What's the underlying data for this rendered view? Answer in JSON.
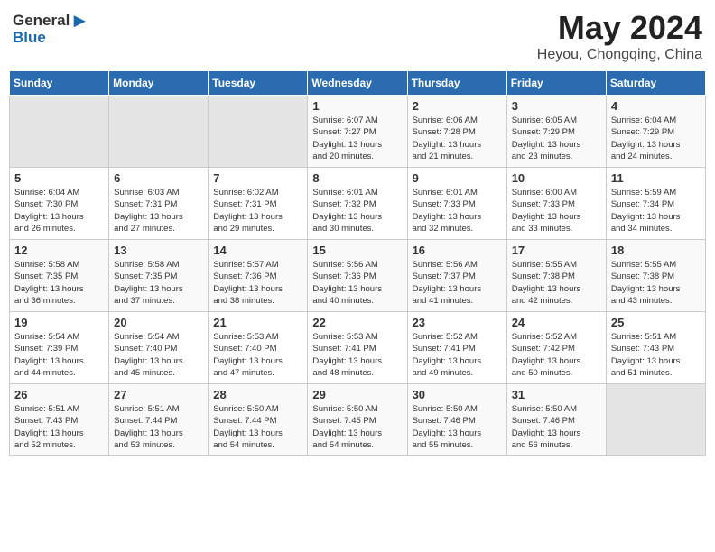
{
  "logo": {
    "general": "General",
    "blue": "Blue"
  },
  "title": {
    "month_year": "May 2024",
    "location": "Heyou, Chongqing, China"
  },
  "days_of_week": [
    "Sunday",
    "Monday",
    "Tuesday",
    "Wednesday",
    "Thursday",
    "Friday",
    "Saturday"
  ],
  "weeks": [
    [
      {
        "day": "",
        "info": ""
      },
      {
        "day": "",
        "info": ""
      },
      {
        "day": "",
        "info": ""
      },
      {
        "day": "1",
        "info": "Sunrise: 6:07 AM\nSunset: 7:27 PM\nDaylight: 13 hours\nand 20 minutes."
      },
      {
        "day": "2",
        "info": "Sunrise: 6:06 AM\nSunset: 7:28 PM\nDaylight: 13 hours\nand 21 minutes."
      },
      {
        "day": "3",
        "info": "Sunrise: 6:05 AM\nSunset: 7:29 PM\nDaylight: 13 hours\nand 23 minutes."
      },
      {
        "day": "4",
        "info": "Sunrise: 6:04 AM\nSunset: 7:29 PM\nDaylight: 13 hours\nand 24 minutes."
      }
    ],
    [
      {
        "day": "5",
        "info": "Sunrise: 6:04 AM\nSunset: 7:30 PM\nDaylight: 13 hours\nand 26 minutes."
      },
      {
        "day": "6",
        "info": "Sunrise: 6:03 AM\nSunset: 7:31 PM\nDaylight: 13 hours\nand 27 minutes."
      },
      {
        "day": "7",
        "info": "Sunrise: 6:02 AM\nSunset: 7:31 PM\nDaylight: 13 hours\nand 29 minutes."
      },
      {
        "day": "8",
        "info": "Sunrise: 6:01 AM\nSunset: 7:32 PM\nDaylight: 13 hours\nand 30 minutes."
      },
      {
        "day": "9",
        "info": "Sunrise: 6:01 AM\nSunset: 7:33 PM\nDaylight: 13 hours\nand 32 minutes."
      },
      {
        "day": "10",
        "info": "Sunrise: 6:00 AM\nSunset: 7:33 PM\nDaylight: 13 hours\nand 33 minutes."
      },
      {
        "day": "11",
        "info": "Sunrise: 5:59 AM\nSunset: 7:34 PM\nDaylight: 13 hours\nand 34 minutes."
      }
    ],
    [
      {
        "day": "12",
        "info": "Sunrise: 5:58 AM\nSunset: 7:35 PM\nDaylight: 13 hours\nand 36 minutes."
      },
      {
        "day": "13",
        "info": "Sunrise: 5:58 AM\nSunset: 7:35 PM\nDaylight: 13 hours\nand 37 minutes."
      },
      {
        "day": "14",
        "info": "Sunrise: 5:57 AM\nSunset: 7:36 PM\nDaylight: 13 hours\nand 38 minutes."
      },
      {
        "day": "15",
        "info": "Sunrise: 5:56 AM\nSunset: 7:36 PM\nDaylight: 13 hours\nand 40 minutes."
      },
      {
        "day": "16",
        "info": "Sunrise: 5:56 AM\nSunset: 7:37 PM\nDaylight: 13 hours\nand 41 minutes."
      },
      {
        "day": "17",
        "info": "Sunrise: 5:55 AM\nSunset: 7:38 PM\nDaylight: 13 hours\nand 42 minutes."
      },
      {
        "day": "18",
        "info": "Sunrise: 5:55 AM\nSunset: 7:38 PM\nDaylight: 13 hours\nand 43 minutes."
      }
    ],
    [
      {
        "day": "19",
        "info": "Sunrise: 5:54 AM\nSunset: 7:39 PM\nDaylight: 13 hours\nand 44 minutes."
      },
      {
        "day": "20",
        "info": "Sunrise: 5:54 AM\nSunset: 7:40 PM\nDaylight: 13 hours\nand 45 minutes."
      },
      {
        "day": "21",
        "info": "Sunrise: 5:53 AM\nSunset: 7:40 PM\nDaylight: 13 hours\nand 47 minutes."
      },
      {
        "day": "22",
        "info": "Sunrise: 5:53 AM\nSunset: 7:41 PM\nDaylight: 13 hours\nand 48 minutes."
      },
      {
        "day": "23",
        "info": "Sunrise: 5:52 AM\nSunset: 7:41 PM\nDaylight: 13 hours\nand 49 minutes."
      },
      {
        "day": "24",
        "info": "Sunrise: 5:52 AM\nSunset: 7:42 PM\nDaylight: 13 hours\nand 50 minutes."
      },
      {
        "day": "25",
        "info": "Sunrise: 5:51 AM\nSunset: 7:43 PM\nDaylight: 13 hours\nand 51 minutes."
      }
    ],
    [
      {
        "day": "26",
        "info": "Sunrise: 5:51 AM\nSunset: 7:43 PM\nDaylight: 13 hours\nand 52 minutes."
      },
      {
        "day": "27",
        "info": "Sunrise: 5:51 AM\nSunset: 7:44 PM\nDaylight: 13 hours\nand 53 minutes."
      },
      {
        "day": "28",
        "info": "Sunrise: 5:50 AM\nSunset: 7:44 PM\nDaylight: 13 hours\nand 54 minutes."
      },
      {
        "day": "29",
        "info": "Sunrise: 5:50 AM\nSunset: 7:45 PM\nDaylight: 13 hours\nand 54 minutes."
      },
      {
        "day": "30",
        "info": "Sunrise: 5:50 AM\nSunset: 7:46 PM\nDaylight: 13 hours\nand 55 minutes."
      },
      {
        "day": "31",
        "info": "Sunrise: 5:50 AM\nSunset: 7:46 PM\nDaylight: 13 hours\nand 56 minutes."
      },
      {
        "day": "",
        "info": ""
      }
    ]
  ]
}
